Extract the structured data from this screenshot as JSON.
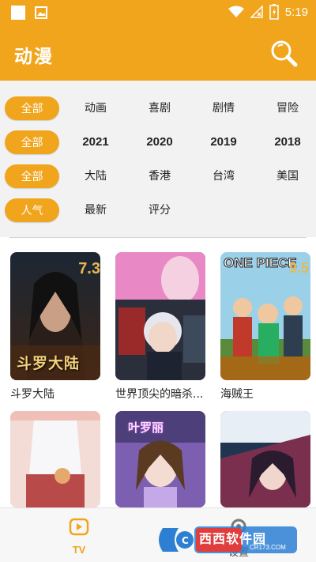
{
  "status_bar": {
    "time": "5:19"
  },
  "header": {
    "title": "动漫"
  },
  "filters": {
    "type_row": {
      "selected": "全部",
      "options": [
        "动画",
        "喜剧",
        "剧情",
        "冒险"
      ]
    },
    "year_row": {
      "selected": "全部",
      "options": [
        "2021",
        "2020",
        "2019",
        "2018"
      ]
    },
    "region_row": {
      "selected": "全部",
      "options": [
        "大陆",
        "香港",
        "台湾",
        "美国"
      ]
    },
    "sort_row": {
      "selected": "人气",
      "options": [
        "最新",
        "评分"
      ]
    }
  },
  "grid": {
    "items": [
      {
        "title": "斗罗大陆",
        "score": "7.3",
        "poster_text": "斗罗大陆"
      },
      {
        "title": "世界顶尖的暗杀...",
        "score": "",
        "poster_text": ""
      },
      {
        "title": "海贼王",
        "score": "9.5",
        "poster_text": "ONE PIECE"
      },
      {
        "title": "",
        "score": "",
        "poster_text": ""
      },
      {
        "title": "",
        "score": "",
        "poster_text": "叶罗丽"
      },
      {
        "title": "",
        "score": "",
        "poster_text": ""
      }
    ]
  },
  "bottom_nav": {
    "tv_label": "TV",
    "settings_label": "设置"
  },
  "watermark": {
    "text": "西西软件园",
    "url": "CR173.COM"
  },
  "colors": {
    "accent": "#f0a51d",
    "background": "#f2f2f2"
  }
}
